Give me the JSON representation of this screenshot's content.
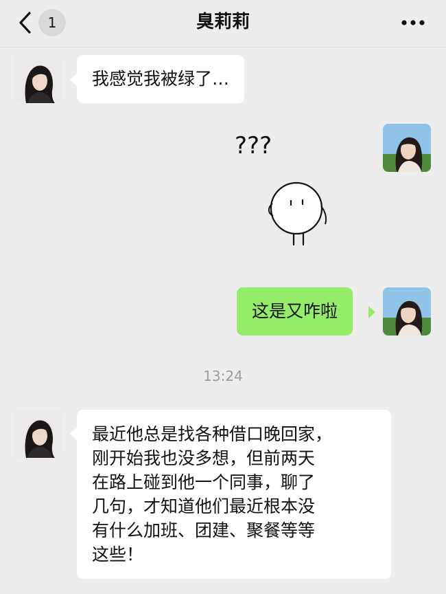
{
  "header": {
    "title": "臭莉莉",
    "unread_count": "1",
    "back_icon": "chevron-left-icon",
    "more_icon": "more-dots-icon"
  },
  "messages": [
    {
      "sender": "contact",
      "type": "text",
      "text": "我感觉我被绿了…"
    },
    {
      "sender": "me",
      "type": "sticker",
      "text": "???"
    },
    {
      "sender": "me",
      "type": "text",
      "text": "这是又咋啦"
    }
  ],
  "timestamp": "13:24",
  "messages_after": [
    {
      "sender": "contact",
      "type": "text",
      "lines": [
        "最近他总是找各种借口晚回家，",
        "刚开始我也没多想，但前两天",
        "在路上碰到他一个同事，聊了",
        "几句，才知道他们最近根本没",
        "有什么加班、团建、聚餐等等",
        "这些！"
      ]
    }
  ],
  "colors": {
    "background": "#ededed",
    "incoming_bubble": "#ffffff",
    "outgoing_bubble": "#95ec69",
    "timestamp": "#9c9c9c"
  }
}
